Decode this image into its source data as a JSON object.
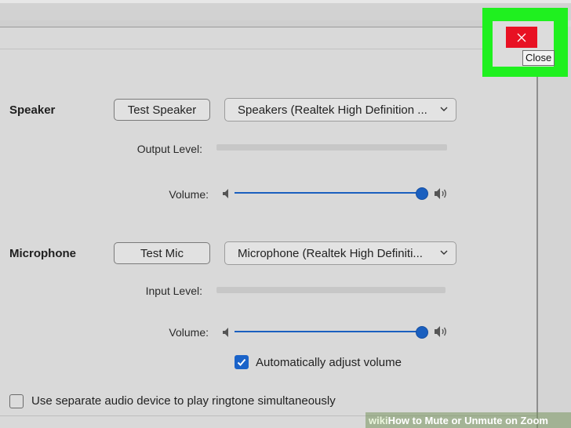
{
  "window": {
    "close_label": "Close",
    "close_color": "#e81123",
    "highlight_color": "#1ff01f"
  },
  "speaker": {
    "section_label": "Speaker",
    "test_button": "Test Speaker",
    "device": "Speakers (Realtek High Definition ...",
    "output_level_label": "Output Level:",
    "volume_label": "Volume:",
    "volume_fraction": 1.0
  },
  "microphone": {
    "section_label": "Microphone",
    "test_button": "Test Mic",
    "device": "Microphone (Realtek High Definiti...",
    "input_level_label": "Input Level:",
    "volume_label": "Volume:",
    "volume_fraction": 1.0,
    "auto_adjust": {
      "label": "Automatically adjust volume",
      "checked": true
    }
  },
  "ringtone": {
    "label": "Use separate audio device to play ringtone simultaneously",
    "checked": false
  },
  "watermark": {
    "prefix": "wiki",
    "text": "How to Mute or Unmute on Zoom"
  },
  "colors": {
    "accent": "#1a5fbf",
    "checkbox_checked": "#1a63c9"
  },
  "icons": [
    "close-icon",
    "chevron-down-icon",
    "speaker-low-icon",
    "speaker-high-icon",
    "checkmark-icon"
  ]
}
